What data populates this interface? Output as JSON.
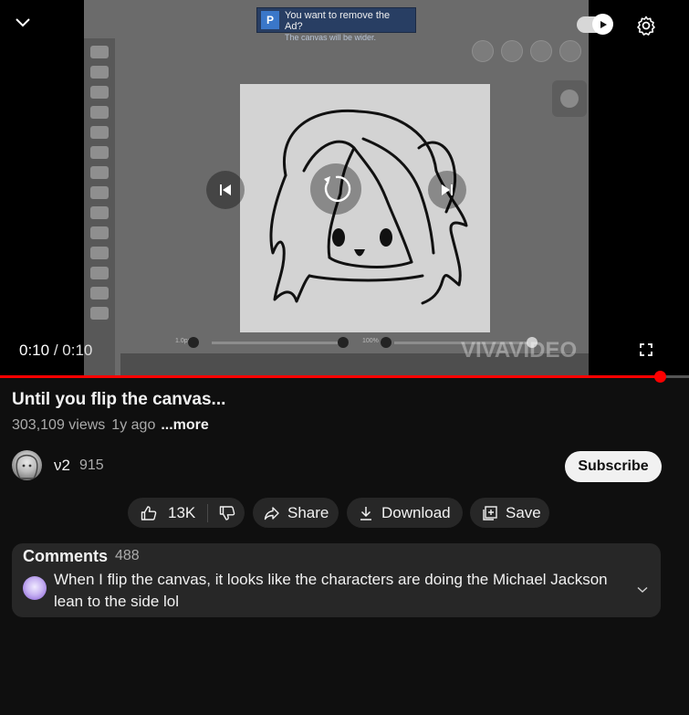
{
  "player": {
    "ad_line1": "You want to remove the Ad?",
    "ad_line2": "The canvas will be wider.",
    "watermark": "VIVAVIDEO",
    "current_time": "0:10",
    "separator": " / ",
    "duration": "0:10",
    "progress": 0.957,
    "icons": [
      "chevron-down-icon",
      "autoplay-toggle-icon",
      "settings-gear-icon",
      "skip-previous-icon",
      "replay-icon",
      "skip-next-icon",
      "fullscreen-icon"
    ],
    "accent": "#ff0000"
  },
  "video": {
    "title": "Until you flip the canvas...",
    "views": "303,109 views",
    "age": "1y ago",
    "more": "...more"
  },
  "channel": {
    "name": "ν2",
    "subscribers": "915",
    "subscribe_label": "Subscribe"
  },
  "actions": {
    "likes": "13K",
    "share": "Share",
    "download": "Download",
    "save": "Save"
  },
  "comments": {
    "heading": "Comments",
    "count": "488",
    "top_comment": "When I flip the canvas, it looks like the characters are doing the Michael Jackson lean to the side lol"
  }
}
